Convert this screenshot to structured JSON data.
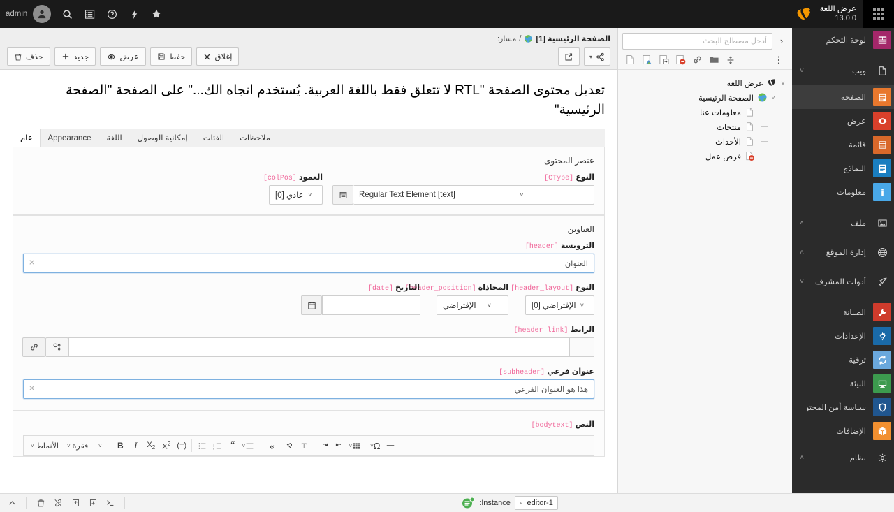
{
  "topbar": {
    "username": "admin",
    "brand_title": "عرض اللغة",
    "brand_version": "13.0.0",
    "buttons": [
      {
        "name": "avatar",
        "label": "admin"
      },
      {
        "name": "search-icon",
        "label": "بحث"
      },
      {
        "name": "list-icon",
        "label": "قائمة"
      },
      {
        "name": "help-icon",
        "label": "مساعدة"
      },
      {
        "name": "flash-icon",
        "label": "إجراءات سريعة"
      },
      {
        "name": "bookmark-star-icon",
        "label": "المفضلة"
      }
    ]
  },
  "modulemenu": {
    "items": [
      {
        "label": "لوحة التحكم",
        "icon": "dashboard-icon",
        "color": "#a4276a",
        "chevron": "",
        "active": false,
        "group": false
      },
      {
        "label": "ويب",
        "icon": "page-doc-icon",
        "color": "#2b2b2b",
        "chevron": "˅",
        "active": false,
        "group": true
      },
      {
        "label": "الصفحة",
        "icon": "page-icon",
        "color": "#e8782d",
        "chevron": "",
        "active": true,
        "group": false
      },
      {
        "label": "عرض",
        "icon": "eye-icon",
        "color": "#d9402b",
        "chevron": "",
        "active": false,
        "group": false
      },
      {
        "label": "قائمة",
        "icon": "list-module-icon",
        "color": "#d9682a",
        "chevron": "",
        "active": false,
        "group": false
      },
      {
        "label": "النماذج",
        "icon": "forms-icon",
        "color": "#1a7ec0",
        "chevron": "",
        "active": false,
        "group": false
      },
      {
        "label": "معلومات",
        "icon": "info-icon",
        "color": "#49a8e8",
        "chevron": "",
        "active": false,
        "group": false
      },
      {
        "label": "ملف",
        "icon": "file-image-icon",
        "color": "#2b2b2b",
        "chevron": "˄",
        "active": false,
        "group": true
      },
      {
        "label": "إدارة الموقع",
        "icon": "globe-icon",
        "color": "#2b2b2b",
        "chevron": "˄",
        "active": false,
        "group": true
      },
      {
        "label": "أدوات المشرف",
        "icon": "rocket-icon",
        "color": "#2b2b2b",
        "chevron": "˅",
        "active": false,
        "group": true
      },
      {
        "label": "الصيانة",
        "icon": "wrench-icon",
        "color": "#cf3b2c",
        "chevron": "",
        "active": false,
        "group": false
      },
      {
        "label": "الإعدادات",
        "icon": "gear-icon",
        "color": "#1a6aa8",
        "chevron": "",
        "active": false,
        "group": false
      },
      {
        "label": "ترقية",
        "icon": "refresh-icon",
        "color": "#6aa8dd",
        "chevron": "",
        "active": false,
        "group": false
      },
      {
        "label": "البيئة",
        "icon": "monitor-icon",
        "color": "#3c9a4e",
        "chevron": "",
        "active": false,
        "group": false
      },
      {
        "label": "سياسة أمن المحتوى",
        "icon": "shield-icon",
        "color": "#20568f",
        "chevron": "",
        "active": false,
        "group": false
      },
      {
        "label": "الإضافات",
        "icon": "box-icon",
        "color": "#f29030",
        "chevron": "",
        "active": false,
        "group": false
      },
      {
        "label": "نظام",
        "icon": "gear-outline-icon",
        "color": "#2b2b2b",
        "chevron": "˄",
        "active": false,
        "group": true
      }
    ]
  },
  "pagetree": {
    "search_placeholder": "أدخل مصطلح البحث",
    "search_value": "",
    "toolbar_icons": [
      "new-page-icon",
      "filter-page-icon",
      "paste-into-icon",
      "remove-page-icon",
      "link-icon",
      "folder-icon",
      "sort-icon",
      "more-options-icon"
    ],
    "root": {
      "label": "عرض اللغة",
      "icon": "typo3-root-icon",
      "twisty": "˅"
    },
    "level1": {
      "label": "الصفحة الرئيسية",
      "icon": "globe-page-icon",
      "twisty": "˅"
    },
    "children": [
      {
        "label": "معلومات عنا",
        "icon": "page-doc-icon"
      },
      {
        "label": "منتجات",
        "icon": "page-doc-icon"
      },
      {
        "label": "الأحداث",
        "icon": "page-doc-icon"
      },
      {
        "label": "فرص عمل",
        "icon": "page-hidden-icon"
      }
    ]
  },
  "docheader": {
    "breadcrumb_label": "مسار:",
    "breadcrumb_sep": "/",
    "breadcrumb_page": "الصفحة الرئيسية [1]",
    "left_buttons": [
      {
        "name": "share-button",
        "label": "",
        "icon": "share-icon"
      },
      {
        "name": "open-in-new-window-button",
        "label": "",
        "icon": "external-link-icon"
      }
    ],
    "right_buttons": [
      {
        "name": "close-button",
        "label": "إغلاق",
        "icon": "close-x-icon"
      },
      {
        "name": "save-button",
        "label": "حفظ",
        "icon": "save-disk-icon"
      },
      {
        "name": "view-button",
        "label": "عرض",
        "icon": "eye-icon"
      },
      {
        "name": "new-button",
        "label": "جديد",
        "icon": "plus-icon"
      },
      {
        "name": "delete-button",
        "label": "حذف",
        "icon": "trash-icon"
      }
    ]
  },
  "main": {
    "page_title": "تعديل محتوى الصفحة \"RTL لا تتعلق فقط باللغة العربية. يُستخدم اتجاه الك...\" على الصفحة \"الصفحة الرئيسية\"",
    "tabs": [
      {
        "label": "عام",
        "active": true
      },
      {
        "label": "Appearance",
        "active": false
      },
      {
        "label": "اللغة",
        "active": false
      },
      {
        "label": "إمكانية الوصول",
        "active": false
      },
      {
        "label": "الفئات",
        "active": false
      },
      {
        "label": "ملاحظات",
        "active": false
      }
    ],
    "content_element": {
      "section_title": "عنصر المحتوى",
      "ctype": {
        "label": "النوع",
        "code": "[CType]",
        "value": "Regular Text Element [text]"
      },
      "colpos": {
        "label": "العمود",
        "code": "[colPos]",
        "value": "عادي [0]"
      }
    },
    "headers": {
      "section_title": "العناوين",
      "header": {
        "label": "الترويسة",
        "code": "[header]",
        "value": "العنوان"
      },
      "header_layout": {
        "label": "النوع",
        "code": "[header_layout]",
        "value": "الإفتراضي [0]"
      },
      "header_position": {
        "label": "المحاذاة",
        "code": "[header_position]",
        "value": "الإفتراضي"
      },
      "date": {
        "label": "التاريخ",
        "code": "[date]",
        "value": ""
      },
      "header_link": {
        "label": "الرابط",
        "code": "[header_link]",
        "value": ""
      },
      "subheader": {
        "label": "عنوان فرعي",
        "code": "[subheader]",
        "value": "هذا هو العنوان الفرعي"
      }
    },
    "bodytext": {
      "label": "النص",
      "code": "[bodytext]",
      "toolbar": [
        {
          "name": "styles-dropdown",
          "label": "الأنماط",
          "caret": "˅"
        },
        {
          "name": "paragraph-format-dropdown",
          "label": "فقرة",
          "caret": "˅"
        },
        {
          "name": "font-size-dropdown",
          "label": "",
          "caret": "˅"
        },
        {
          "name": "bold-button",
          "label": "B"
        },
        {
          "name": "italic-button",
          "label": "I"
        },
        {
          "name": "subscript-button",
          "label": "X₂"
        },
        {
          "name": "superscript-button",
          "label": "X²"
        },
        {
          "name": "remove-format-button",
          "label": "(=)"
        },
        {
          "name": "bulleted-list-button",
          "label": "•—"
        },
        {
          "name": "numbered-list-button",
          "label": "1—"
        },
        {
          "name": "blockquote-button",
          "label": "“"
        },
        {
          "name": "alignment-dropdown",
          "label": "≡",
          "caret": "˅"
        },
        {
          "name": "undo-redo-group",
          "label": ""
        },
        {
          "name": "link-button",
          "label": ""
        },
        {
          "name": "unlink-button",
          "label": ""
        },
        {
          "name": "remove-text-format-button",
          "label": "T"
        },
        {
          "name": "redo-button",
          "label": "↷"
        },
        {
          "name": "undo-button",
          "label": "↶"
        },
        {
          "name": "insert-table-button",
          "label": "▦",
          "caret": "˅"
        },
        {
          "name": "special-character-button",
          "label": "Ω",
          "caret": "˅"
        },
        {
          "name": "horizontal-rule-button",
          "label": "—"
        }
      ]
    }
  },
  "statusbar": {
    "icons": [
      "collapse-chevron-icon",
      "trash-icon",
      "unlink-icon",
      "export-icon",
      "import-icon",
      "console-icon"
    ],
    "instance_label": "Instance:",
    "instance_value": "editor-1",
    "instance_caret": "˅",
    "badge_icon": "typo3-console-badge-icon"
  }
}
